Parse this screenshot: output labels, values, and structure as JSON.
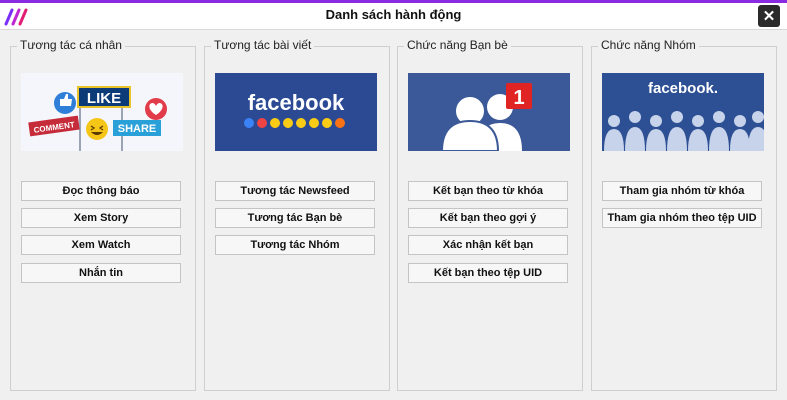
{
  "window": {
    "title": "Danh sách hành động",
    "close_icon": "close-icon",
    "accent_color": "#8a2be2"
  },
  "groups": [
    {
      "label": "Tương tác cá nhân",
      "image_icon": "social-interaction-icon",
      "image_texts": [
        "LIKE",
        "COMMENT",
        "SHARE"
      ],
      "buttons": [
        "Đọc thông báo",
        "Xem Story",
        "Xem Watch",
        "Nhắn tin"
      ]
    },
    {
      "label": "Tương tác bài viết",
      "image_icon": "facebook-reactions-icon",
      "image_texts": [
        "facebook"
      ],
      "buttons": [
        "Tương tác Newsfeed",
        "Tương tác Bạn bè",
        "Tương tác Nhóm"
      ]
    },
    {
      "label": "Chức năng Bạn bè",
      "image_icon": "friend-request-icon",
      "image_texts": [
        "1"
      ],
      "buttons": [
        "Kết bạn theo từ khóa",
        "Kết bạn theo gợi ý",
        "Xác nhận kết bạn",
        "Kết bạn theo tệp UID"
      ]
    },
    {
      "label": "Chức năng Nhóm",
      "image_icon": "facebook-group-icon",
      "image_texts": [
        "facebook."
      ],
      "buttons": [
        "Tham gia nhóm từ khóa",
        "Tham gia nhóm theo tệp UID"
      ]
    }
  ]
}
